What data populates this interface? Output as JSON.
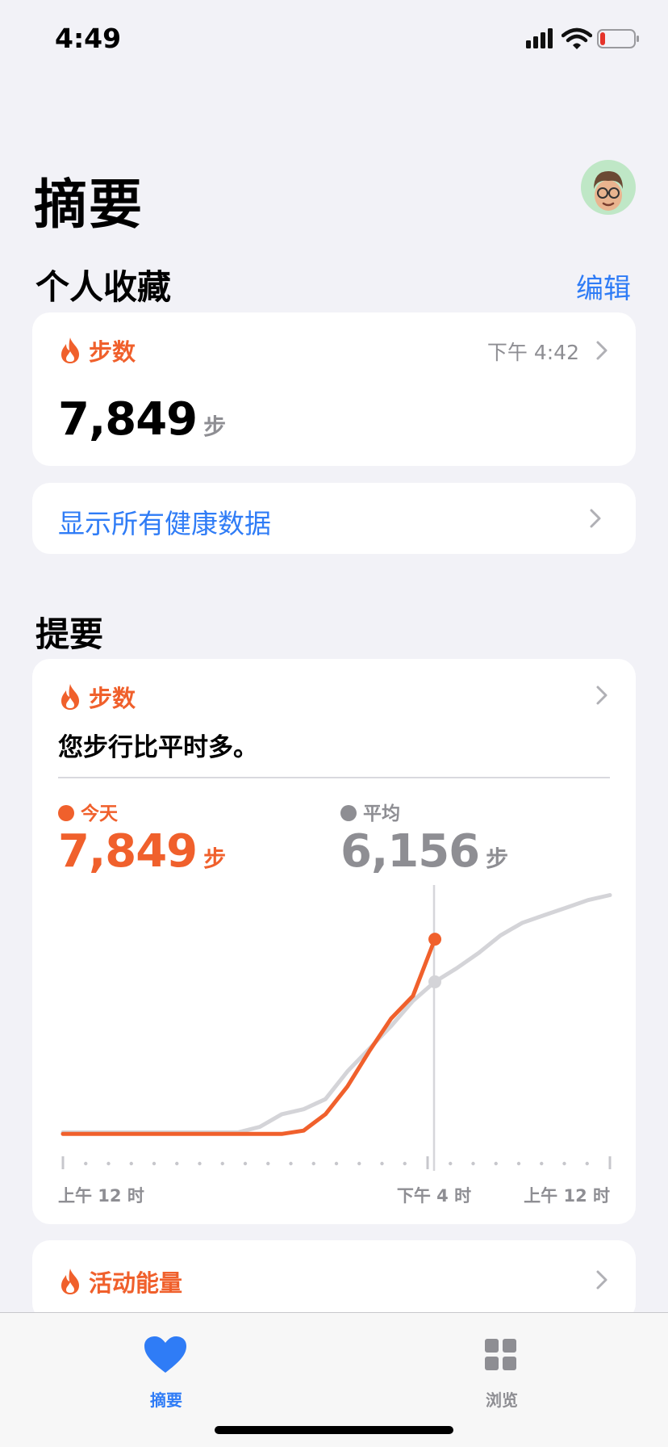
{
  "status_bar": {
    "time": "4:49",
    "battery_level": 0.15
  },
  "header": {
    "title": "摘要"
  },
  "favorites": {
    "title": "个人收藏",
    "edit_label": "编辑",
    "steps_card": {
      "label": "步数",
      "time": "下午 4:42",
      "value": "7,849",
      "unit": "步",
      "icon": "flame-icon"
    },
    "show_all_label": "显示所有健康数据"
  },
  "highlights": {
    "title": "提要",
    "steps_card": {
      "label": "步数",
      "message": "您步行比平时多。",
      "today_label": "今天",
      "today_value": "7,849",
      "today_unit": "步",
      "average_label": "平均",
      "average_value": "6,156",
      "average_unit": "步",
      "x_ticks": [
        "上午 12 时",
        "下午 4 时",
        "上午 12 时"
      ]
    },
    "energy_card": {
      "label": "活动能量"
    }
  },
  "tab_bar": {
    "tabs": [
      {
        "label": "摘要",
        "icon": "heart-icon",
        "active": true
      },
      {
        "label": "浏览",
        "icon": "grid-icon",
        "active": false
      }
    ]
  },
  "colors": {
    "accent": "#F0602C",
    "link": "#2F7CF6",
    "average_line": "#D4D4D8",
    "background": "#F2F2F7"
  },
  "chart_data": {
    "type": "line",
    "x": [
      "上午 12 时",
      "下午 4 时",
      "上午 12 时"
    ],
    "xlabel": "",
    "ylabel": "",
    "series": [
      {
        "name": "今天",
        "values": [
          120,
          120,
          120,
          120,
          120,
          120,
          120,
          120,
          120,
          120,
          120,
          250,
          900,
          2000,
          3400,
          4700,
          5600,
          7849
        ]
      },
      {
        "name": "平均",
        "values": [
          180,
          180,
          180,
          180,
          180,
          180,
          180,
          180,
          180,
          400,
          900,
          1100,
          1500,
          2600,
          3500,
          4400,
          5400,
          6156,
          6700,
          7300,
          8000,
          8500,
          8800,
          9100,
          9400,
          9600
        ]
      }
    ],
    "note_values_are_cumulative_steps": "",
    "ylim": [
      0,
      10000
    ]
  }
}
